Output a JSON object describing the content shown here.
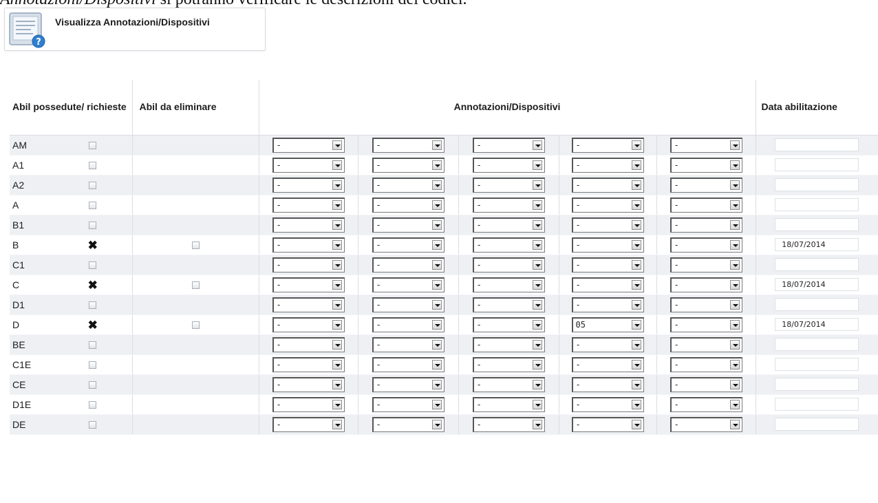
{
  "caption": {
    "italic_part": "Annotazioni/Dispositivi",
    "rest": " si potranno verificare le descrizioni dei codici."
  },
  "view_button": {
    "label": "Visualizza Annotazioni/Dispositivi",
    "icon": "document-help-icon"
  },
  "table": {
    "headers": {
      "owned": "Abil possedute/ richieste",
      "remove": "Abil da eliminare",
      "annotations": "Annotazioni/Dispositivi",
      "date": "Data abilitazione"
    },
    "rows": [
      {
        "code": "AM",
        "possessed": false,
        "s": [
          "-",
          "-",
          "-",
          "-",
          "-"
        ],
        "date": ""
      },
      {
        "code": "A1",
        "possessed": false,
        "s": [
          "-",
          "-",
          "-",
          "-",
          "-"
        ],
        "date": ""
      },
      {
        "code": "A2",
        "possessed": false,
        "s": [
          "-",
          "-",
          "-",
          "-",
          "-"
        ],
        "date": ""
      },
      {
        "code": "A",
        "possessed": false,
        "s": [
          "-",
          "-",
          "-",
          "-",
          "-"
        ],
        "date": ""
      },
      {
        "code": "B1",
        "possessed": false,
        "s": [
          "-",
          "-",
          "-",
          "-",
          "-"
        ],
        "date": ""
      },
      {
        "code": "B",
        "possessed": true,
        "mark": "✖",
        "s": [
          "-",
          "-",
          "-",
          "-",
          "-"
        ],
        "date": "18/07/2014"
      },
      {
        "code": "C1",
        "possessed": false,
        "s": [
          "-",
          "-",
          "-",
          "-",
          "-"
        ],
        "date": ""
      },
      {
        "code": "C",
        "possessed": true,
        "mark": "✖",
        "s": [
          "-",
          "-",
          "-",
          "-",
          "-"
        ],
        "date": "18/07/2014"
      },
      {
        "code": "D1",
        "possessed": false,
        "s": [
          "-",
          "-",
          "-",
          "-",
          "-"
        ],
        "date": ""
      },
      {
        "code": "D",
        "possessed": true,
        "mark": "✖",
        "s": [
          "-",
          "-",
          "-",
          "05",
          "-"
        ],
        "date": "18/07/2014"
      },
      {
        "code": "BE",
        "possessed": false,
        "s": [
          "-",
          "-",
          "-",
          "-",
          "-"
        ],
        "date": ""
      },
      {
        "code": "C1E",
        "possessed": false,
        "s": [
          "-",
          "-",
          "-",
          "-",
          "-"
        ],
        "date": ""
      },
      {
        "code": "CE",
        "possessed": false,
        "s": [
          "-",
          "-",
          "-",
          "-",
          "-"
        ],
        "date": ""
      },
      {
        "code": "D1E",
        "possessed": false,
        "s": [
          "-",
          "-",
          "-",
          "-",
          "-"
        ],
        "date": ""
      },
      {
        "code": "DE",
        "possessed": false,
        "s": [
          "-",
          "-",
          "-",
          "-",
          "-"
        ],
        "date": ""
      }
    ]
  }
}
